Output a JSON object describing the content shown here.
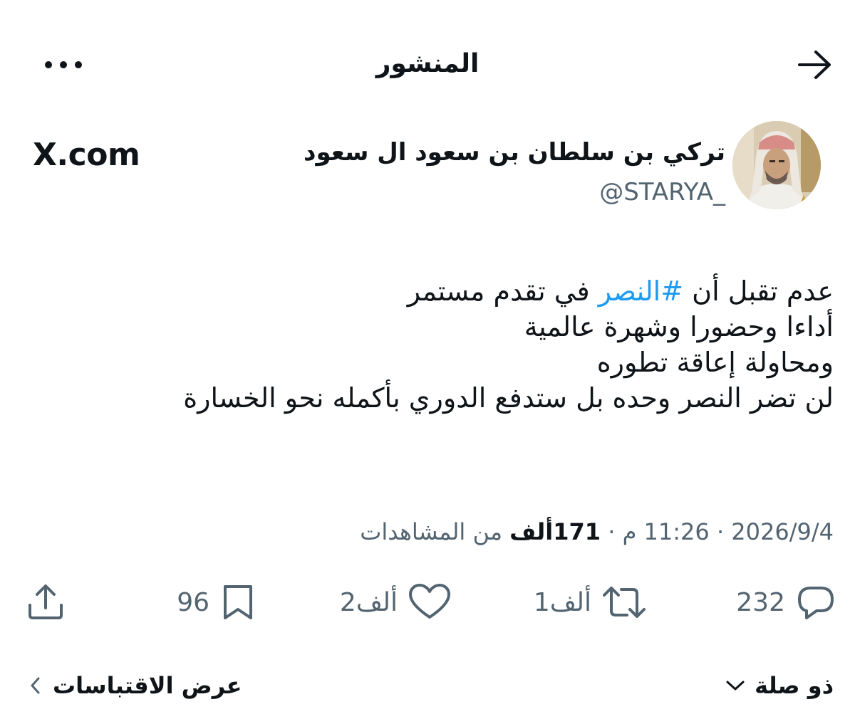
{
  "header": {
    "title": "المنشور"
  },
  "author": {
    "display_name": "تركي بن سلطان بن سعود ال سعود",
    "handle": "@STARYA_"
  },
  "watermark": "X.com",
  "tweet": {
    "line1_part1": "عدم تقبل أن ",
    "line1_hashtag": "#النصر",
    "line1_part2": " في تقدم مستمر",
    "line2": "أداءا وحضورا  وشهرة عالمية",
    "line3": "ومحاولة إعاقة تطوره",
    "line4": "لن تضر النصر وحده بل ستدفع الدوري بأكمله نحو الخسارة"
  },
  "meta": {
    "date": "2026/9/4",
    "sep1": "·",
    "time": "11:26 م",
    "sep2": "·",
    "views_count": "171ألف",
    "views_label": " من المشاهدات"
  },
  "actions": {
    "replies": "232",
    "reposts": "1ألف",
    "likes": "2ألف",
    "bookmarks": "96"
  },
  "links": {
    "relevance": "ذو صلة",
    "view_quotes": "عرض الاقتباسات"
  },
  "icons": {
    "back": "arrow-right-icon",
    "more": "more-dots-icon",
    "reply": "reply-icon",
    "repost": "repost-icon",
    "like": "heart-icon",
    "bookmark": "bookmark-icon",
    "share": "share-icon",
    "relevance_chevron": "chevron-down-icon",
    "quotes_chevron": "chevron-left-icon"
  },
  "colors": {
    "text": "#0f1419",
    "secondary": "#536471",
    "link": "#1d9bf0"
  }
}
